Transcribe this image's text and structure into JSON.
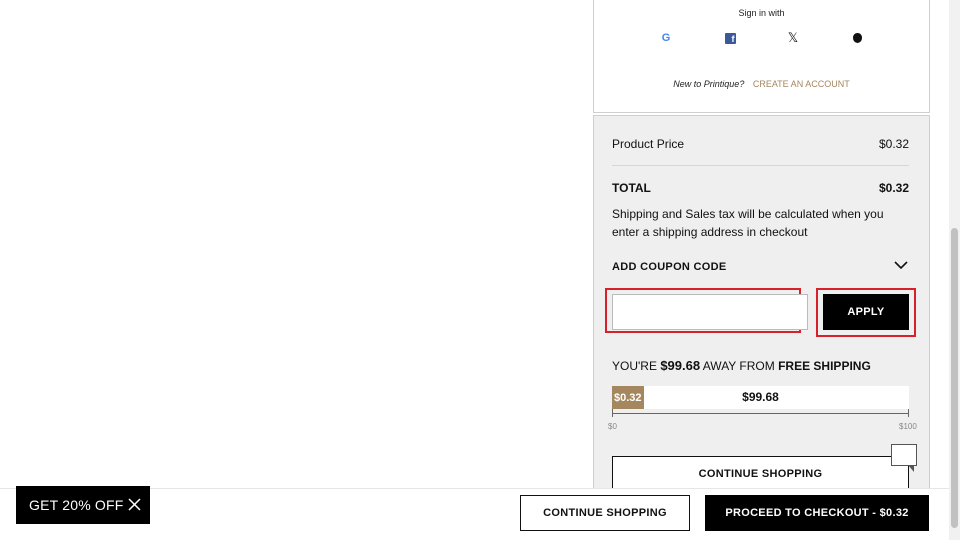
{
  "signin": {
    "title": "Sign in with",
    "providers": [
      {
        "name": "google",
        "glyph": "G"
      },
      {
        "name": "facebook",
        "glyph": "f"
      },
      {
        "name": "x",
        "glyph": "𝕏"
      },
      {
        "name": "apple",
        "glyph": ""
      }
    ],
    "new_prompt": "New to Printique?",
    "create_account": "CREATE AN ACCOUNT"
  },
  "summary": {
    "product_price_label": "Product Price",
    "product_price_value": "$0.32",
    "total_label": "TOTAL",
    "total_value": "$0.32",
    "shipping_note": "Shipping and Sales tax will be calculated when you enter a shipping address in checkout",
    "coupon_label": "ADD COUPON CODE",
    "coupon_input_value": "",
    "apply_label": "APPLY",
    "away_prefix": "YOU'RE",
    "away_amount": "$99.68",
    "away_middle": "AWAY FROM",
    "away_suffix": "FREE SHIPPING",
    "progress_current": "$0.32",
    "progress_remaining": "$99.68",
    "progress_fraction": 0.0032,
    "scale_min": "$0",
    "scale_max": "$100",
    "continue_label": "CONTINUE SHOPPING"
  },
  "promo": {
    "label": "GET 20% OFF"
  },
  "bottom_bar": {
    "continue_label": "CONTINUE SHOPPING",
    "checkout_label": "PROCEED TO CHECKOUT - $0.32"
  },
  "colors": {
    "accent": "#a4875f",
    "highlight": "#d6202a",
    "primary": "#000000"
  }
}
